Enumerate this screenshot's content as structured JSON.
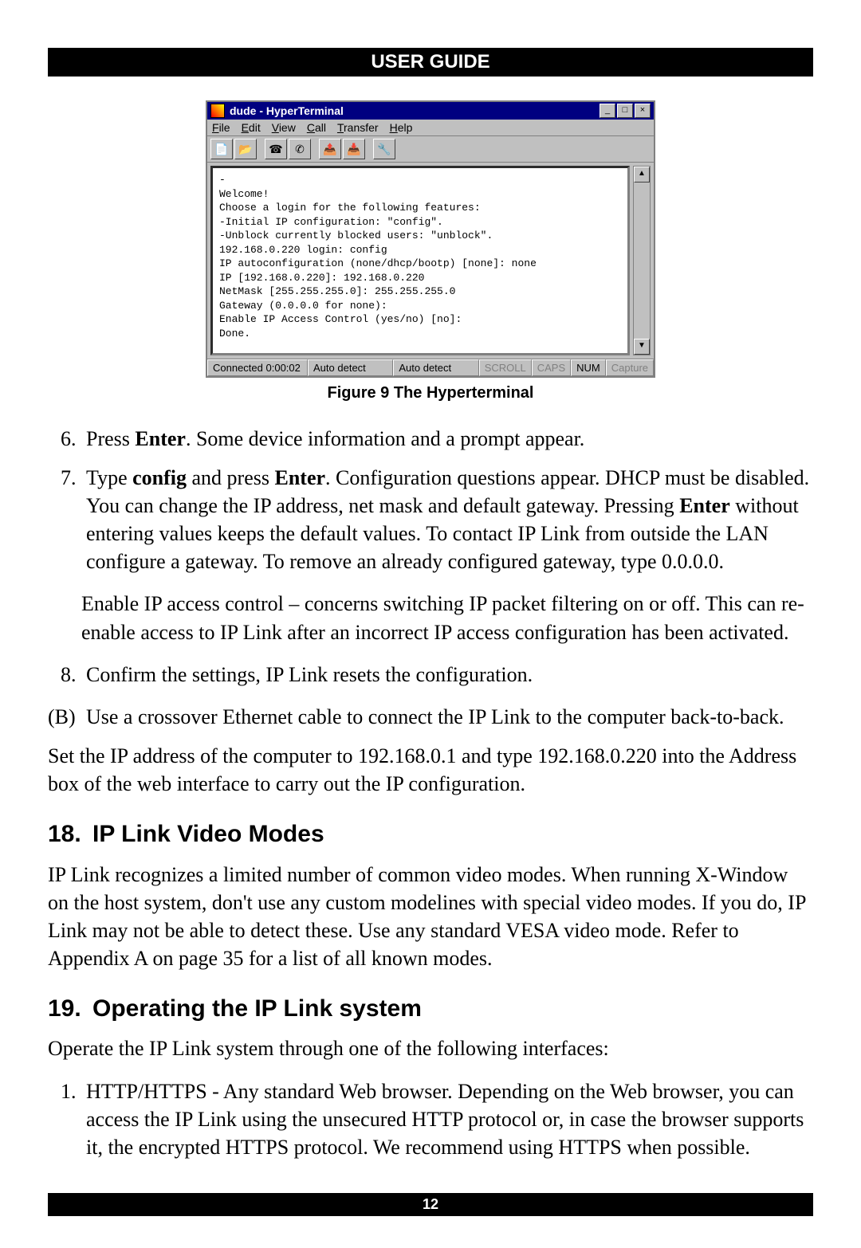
{
  "header": "USER GUIDE",
  "footer_page": "12",
  "hyperterminal": {
    "title": "dude - HyperTerminal",
    "menu": [
      "File",
      "Edit",
      "View",
      "Call",
      "Transfer",
      "Help"
    ],
    "winbtns": {
      "min": "_",
      "max": "□",
      "close": "×"
    },
    "toolbar_icons": [
      "new-doc-icon",
      "open-icon",
      "connect-icon",
      "disconnect-icon",
      "send-icon",
      "receive-icon",
      "properties-icon"
    ],
    "terminal": "-\nWelcome!\nChoose a login for the following features:\n-Initial IP configuration: \"config\".\n-Unblock currently blocked users: \"unblock\".\n192.168.0.220 login: config\nIP autoconfiguration (none/dhcp/bootp) [none]: none\nIP [192.168.0.220]: 192.168.0.220\nNetMask [255.255.255.0]: 255.255.255.0\nGateway (0.0.0.0 for none):\nEnable IP Access Control (yes/no) [no]:\nDone.",
    "status": {
      "connected": "Connected 0:00:02",
      "detect1": "Auto detect",
      "detect2": "Auto detect",
      "scroll": "SCROLL",
      "caps": "CAPS",
      "num": "NUM",
      "capture": "Capture"
    }
  },
  "figure_caption": "Figure 9 The Hyperterminal",
  "step6": {
    "pre": "Press ",
    "b": "Enter",
    "post": ". Some device information and a prompt appear."
  },
  "step7": {
    "a": "Type ",
    "b1": "config",
    "c": " and press ",
    "b2": "Enter",
    "d": ". Configuration questions appear. DHCP must be disabled. You can change the IP address, net mask and default gateway. Pressing ",
    "b3": "Enter",
    "e": " without entering values keeps the default values. To contact IP Link from outside the LAN configure a gateway. To remove an already configured gateway, type 0.0.0.0."
  },
  "step7_extra": "Enable IP access control – concerns switching IP packet filtering on or off. This can re-enable access to IP Link after an incorrect IP access configuration has been activated.",
  "step8": "Confirm the settings, IP Link resets the configuration.",
  "stepB": "Use a crossover Ethernet cable to connect the IP Link to the computer back-to-back.",
  "after_b": "Set the IP address of the computer to 192.168.0.1 and type 192.168.0.220 into the Address box of the web interface to carry out the IP configuration.",
  "sec18": {
    "num": "18.",
    "title": "IP Link Video Modes"
  },
  "sec18_body": "IP Link recognizes a limited number of common video modes. When running X-Window on the host system, don't use any custom modelines with special video modes. If you do, IP Link may not be able to detect these. Use any standard VESA video mode. Refer to Appendix A on page 35 for a list of all known modes.",
  "sec19": {
    "num": "19.",
    "title": "Operating the IP Link system"
  },
  "sec19_intro": "Operate the IP Link system through one of the following interfaces:",
  "sec19_item1": "HTTP/HTTPS - Any standard Web browser. Depending on the Web browser, you can access the IP Link using the unsecured HTTP protocol or, in case the browser supports it, the encrypted HTTPS protocol. We recommend using HTTPS when possible."
}
